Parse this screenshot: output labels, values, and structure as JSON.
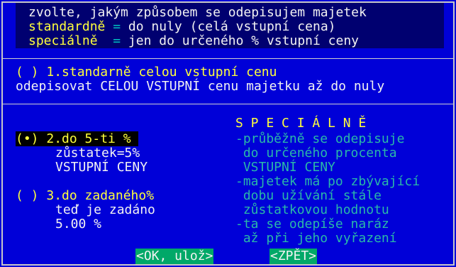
{
  "header": {
    "line1": "zvolte, jakým způsobem se odepisujem majetek",
    "line2_key": "standardně",
    "line2_eq": " = ",
    "line2_val": "do nuly (celá vstupní cena)",
    "line3_key": "speciálně",
    "line3_eq": "  = ",
    "line3_val": "jen do určeného % vstupní ceny"
  },
  "option1": {
    "radio": "( )",
    "label": " 1.standarně celou vstupní cenu",
    "desc": "odepisovat CELOU VSTUPNÍ cenu majetku až do nuly"
  },
  "option2": {
    "radio": "(•)",
    "label": " 2.do 5-ti % ",
    "line2": "zůstatek=5%",
    "line3": "VSTUPNÍ CENY"
  },
  "option3": {
    "radio": "( )",
    "label": " 3.do zadaného%",
    "line2": "teď je zadáno",
    "line3": "5.00 %"
  },
  "special": {
    "title": "S P E C I Á L N Ě",
    "lines": [
      "-průběžně se odepisuje",
      " do určeného procenta",
      " VSTUPNÍ CENY",
      "-majetek má po zbývající",
      " dobu užívání stále",
      " zůstatkovou hodnotu",
      "-ta se odepíše naráz",
      " až při jeho vyřazení"
    ]
  },
  "buttons": {
    "ok": "<OK, ulož>",
    "back": "<ZPĚT>"
  },
  "colors": {
    "background": "#0000d8",
    "highlight": "#ffff3c",
    "text": "#f2f2f2",
    "hint": "#2ab8a8",
    "button": "#00a868"
  }
}
